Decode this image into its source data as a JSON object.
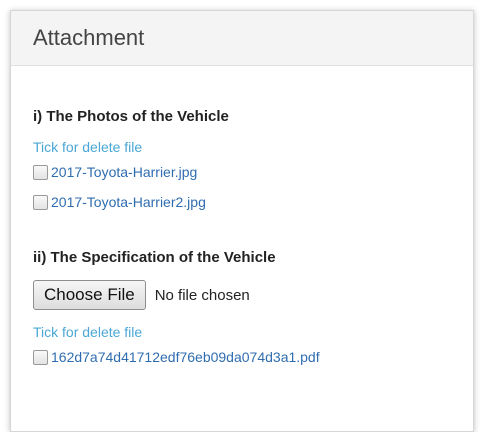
{
  "panel": {
    "title": "Attachment"
  },
  "photos": {
    "title": "i) The Photos of the Vehicle",
    "tick_label": "Tick for delete file",
    "files": [
      "2017-Toyota-Harrier.jpg",
      "2017-Toyota-Harrier2.jpg"
    ]
  },
  "spec": {
    "title": "ii) The Specification of the Vehicle",
    "choose_button": "Choose File",
    "no_file_text": "No file chosen",
    "tick_label": "Tick for delete file",
    "files": [
      "162d7a74d41712edf76eb09da074d3a1.pdf"
    ]
  }
}
